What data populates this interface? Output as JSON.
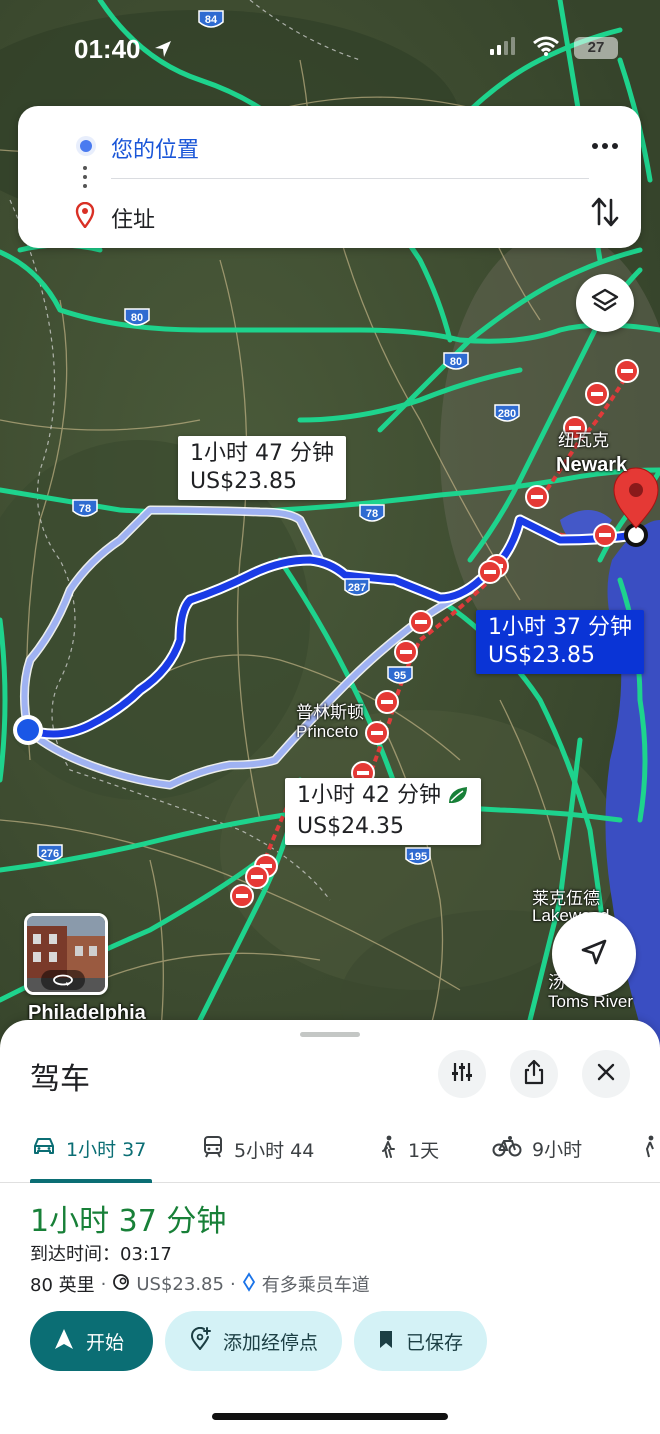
{
  "status_bar": {
    "time": "01:40",
    "battery": "27"
  },
  "search": {
    "origin": "您的位置",
    "destination": "住址"
  },
  "map": {
    "route_callouts": [
      {
        "duration": "1小时 47 分钟",
        "toll": "US$23.85"
      },
      {
        "duration": "1小时 37 分钟",
        "toll": "US$23.85"
      },
      {
        "duration": "1小时 42 分钟",
        "toll": "US$24.35"
      }
    ],
    "place_labels": {
      "newark_zh": "纽瓦克",
      "newark": "Newark",
      "princeton_zh": "普林斯顿",
      "princeton": "Princeto",
      "lakewood_zh": "莱克伍德",
      "lakewood": "Lakewood",
      "toms_river_zh": "汤",
      "toms_river": "Toms River",
      "philadelphia": "Philadelphia"
    },
    "highways": [
      "84",
      "80",
      "80",
      "280",
      "78",
      "78",
      "287",
      "95",
      "276",
      "195"
    ]
  },
  "sheet": {
    "title": "驾车",
    "tabs": [
      {
        "label": "1小时 37",
        "icon": "car-icon",
        "active": true
      },
      {
        "label": "5小时 44",
        "icon": "train-icon",
        "active": false
      },
      {
        "label": "1天",
        "icon": "walk-icon",
        "active": false
      },
      {
        "label": "9小时",
        "icon": "bike-icon",
        "active": false
      }
    ],
    "duration": "1小时 37 分钟",
    "arrival_label": "到达时间：",
    "arrival_time": "03:17",
    "distance": "80 英里",
    "toll": "US$23.85",
    "hov_note": "有多乘员车道",
    "buttons": {
      "start": "开始",
      "add_stop": "添加经停点",
      "saved": "已保存"
    }
  },
  "colors": {
    "route_primary": "#1a3be6",
    "route_alt": "#9fb2f2",
    "traffic_green": "#1ed38d",
    "accent": "#0b6e74",
    "duration_green": "#188038"
  }
}
